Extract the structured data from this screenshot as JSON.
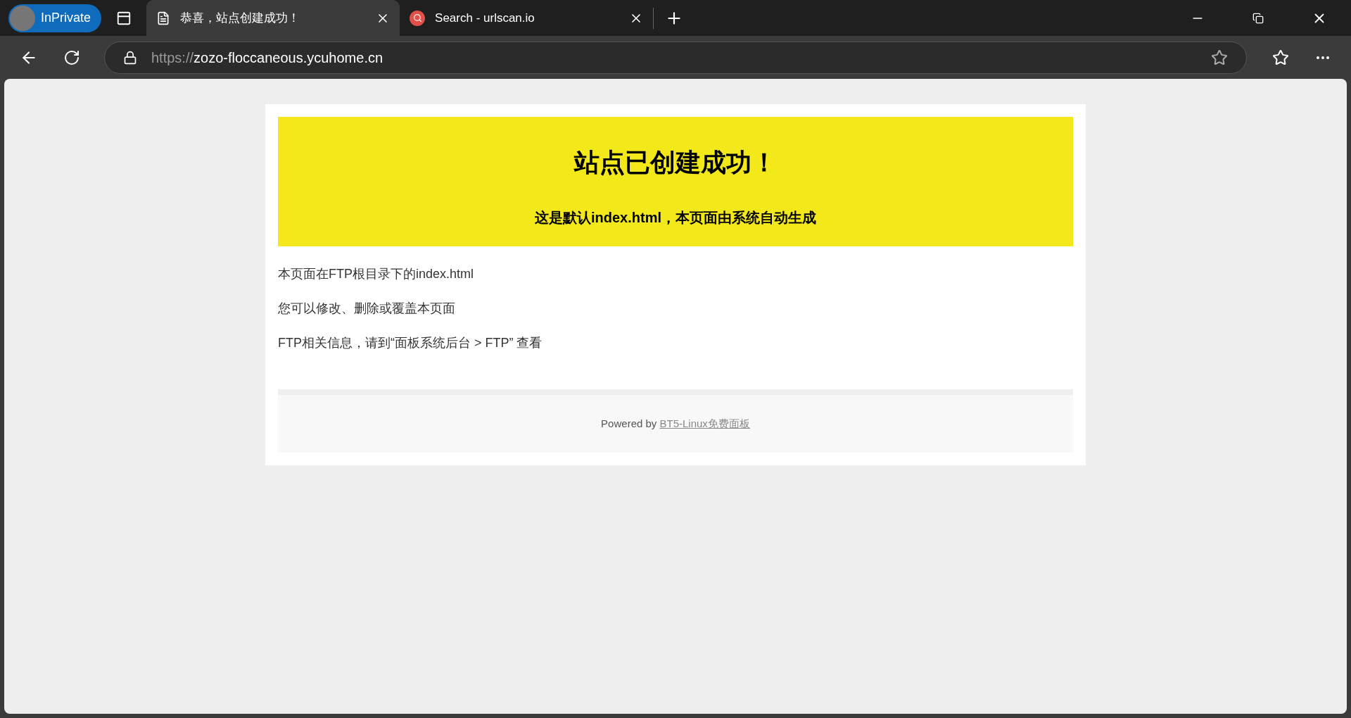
{
  "browser": {
    "profile_label": "InPrivate",
    "tabs": [
      {
        "title": "恭喜，站点创建成功！",
        "selected": true,
        "kind": "page"
      },
      {
        "title": "Search - urlscan.io",
        "selected": false,
        "kind": "search"
      }
    ],
    "address": {
      "scheme": "https://",
      "host": "zozo-floccaneous.ycuhome.cn"
    }
  },
  "page": {
    "banner": {
      "title": "站点已创建成功！",
      "subtitle": "这是默认index.html，本页面由系统自动生成"
    },
    "paragraphs": [
      "本页面在FTP根目录下的index.html",
      "您可以修改、删除或覆盖本页面",
      "FTP相关信息，请到“面板系统后台 > FTP” 查看"
    ],
    "footer": {
      "prefix": "Powered by",
      "link": "BT5-Linux免费面板"
    }
  }
}
